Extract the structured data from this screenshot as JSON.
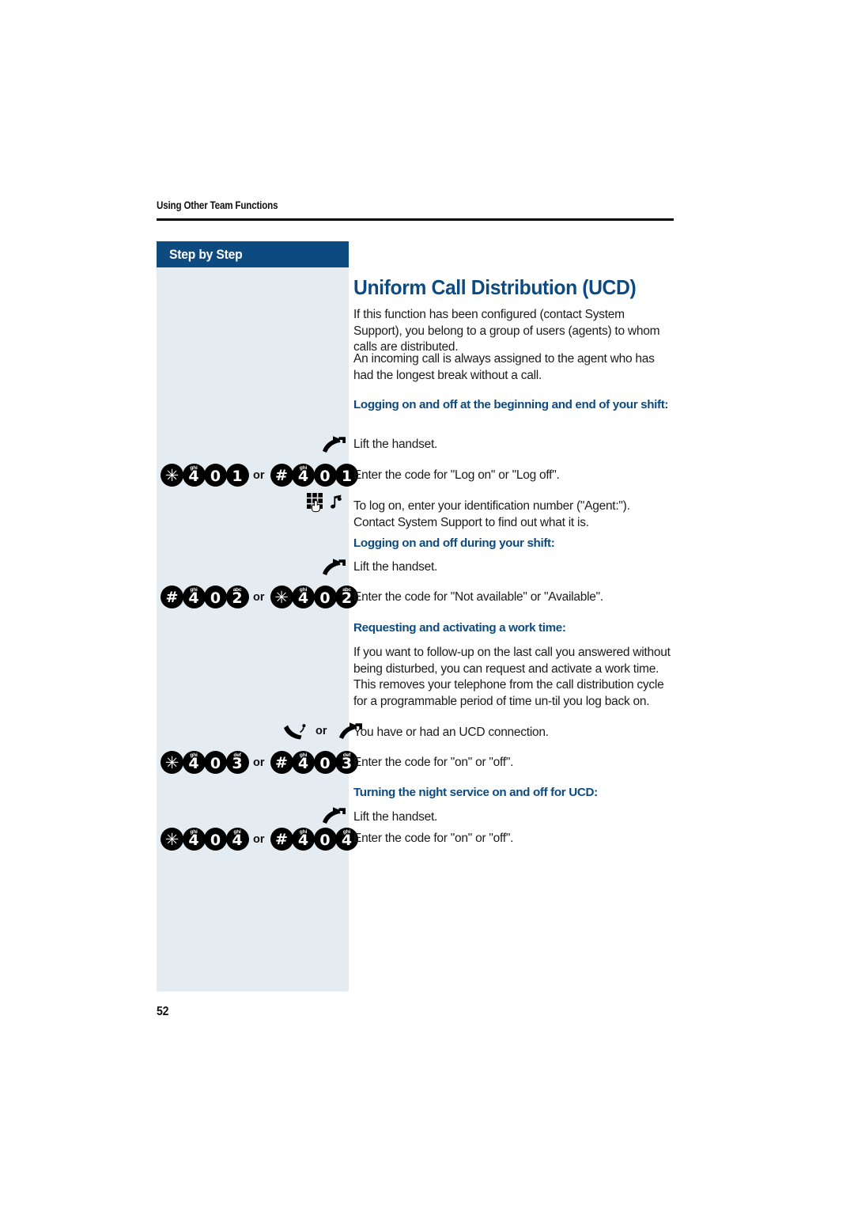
{
  "page": {
    "running_head": "Using Other Team Functions",
    "page_number": "52",
    "accent_color": "#0d4a80",
    "sidebar_color": "#e4ebf1"
  },
  "sidebar": {
    "header_label": "Step by Step"
  },
  "content": {
    "title": "Uniform Call Distribution (UCD)",
    "intro_1": "If this function has been configured (contact System Support), you belong to a group of users (agents) to whom calls are distributed.",
    "intro_2": "An incoming call is always assigned to the agent who has had the longest break without a call.",
    "section_1_heading": "Logging on and off at the beginning and end of your shift:",
    "section_1_step_1": "Lift the handset.",
    "section_1_step_2": "Enter the code for \"Log on\" or \"Log off\".",
    "section_1_step_3": "To log on, enter your identification number (\"Agent:\"). Contact System Support to find out what it is.",
    "section_2_heading": "Logging on and off during your shift:",
    "section_2_step_1": "Lift the handset.",
    "section_2_step_2": "Enter the code for \"Not available\" or \"Available\".",
    "section_3_heading": "Requesting and activating a work time:",
    "section_3_para": "If you want to follow-up on the last call you answered without being disturbed, you can request and activate a work time. This removes your telephone from the call distribution cycle for a programmable period of time un-til you log back on.",
    "section_3_step_1": "You have or had an UCD connection.",
    "section_3_step_2": "Enter the code for \"on\" or \"off\".",
    "section_4_heading": "Turning the night service on and off for UCD:",
    "section_4_step_1": "Lift the handset.",
    "section_4_step_2": "Enter the code for \"on\" or \"off\"."
  },
  "key_sequences": {
    "or_label": "or",
    "row_1": {
      "left": [
        {
          "glyph": "✳",
          "letters": "",
          "type": "star"
        },
        {
          "glyph": "4",
          "letters": "ghi",
          "type": "digit"
        },
        {
          "glyph": "0",
          "letters": "",
          "type": "digit"
        },
        {
          "glyph": "1",
          "letters": "",
          "type": "digit"
        }
      ],
      "right": [
        {
          "glyph": "#",
          "letters": "",
          "type": "hash"
        },
        {
          "glyph": "4",
          "letters": "ghi",
          "type": "digit"
        },
        {
          "glyph": "0",
          "letters": "",
          "type": "digit"
        },
        {
          "glyph": "1",
          "letters": "",
          "type": "digit"
        }
      ]
    },
    "row_2": {
      "left": [
        {
          "glyph": "#",
          "letters": "",
          "type": "hash"
        },
        {
          "glyph": "4",
          "letters": "ghi",
          "type": "digit"
        },
        {
          "glyph": "0",
          "letters": "",
          "type": "digit"
        },
        {
          "glyph": "2",
          "letters": "abc",
          "type": "digit"
        }
      ],
      "right": [
        {
          "glyph": "✳",
          "letters": "",
          "type": "star"
        },
        {
          "glyph": "4",
          "letters": "ghi",
          "type": "digit"
        },
        {
          "glyph": "0",
          "letters": "",
          "type": "digit"
        },
        {
          "glyph": "2",
          "letters": "abc",
          "type": "digit"
        }
      ]
    },
    "row_3": {
      "left": [
        {
          "glyph": "✳",
          "letters": "",
          "type": "star"
        },
        {
          "glyph": "4",
          "letters": "ghi",
          "type": "digit"
        },
        {
          "glyph": "0",
          "letters": "",
          "type": "digit"
        },
        {
          "glyph": "3",
          "letters": "def",
          "type": "digit"
        }
      ],
      "right": [
        {
          "glyph": "#",
          "letters": "",
          "type": "hash"
        },
        {
          "glyph": "4",
          "letters": "ghi",
          "type": "digit"
        },
        {
          "glyph": "0",
          "letters": "",
          "type": "digit"
        },
        {
          "glyph": "3",
          "letters": "def",
          "type": "digit"
        }
      ]
    },
    "row_4": {
      "left": [
        {
          "glyph": "✳",
          "letters": "",
          "type": "star"
        },
        {
          "glyph": "4",
          "letters": "ghi",
          "type": "digit"
        },
        {
          "glyph": "0",
          "letters": "",
          "type": "digit"
        },
        {
          "glyph": "4",
          "letters": "ghi",
          "type": "digit"
        }
      ],
      "right": [
        {
          "glyph": "#",
          "letters": "",
          "type": "hash"
        },
        {
          "glyph": "4",
          "letters": "ghi",
          "type": "digit"
        },
        {
          "glyph": "0",
          "letters": "",
          "type": "digit"
        },
        {
          "glyph": "4",
          "letters": "ghi",
          "type": "digit"
        }
      ]
    }
  },
  "icons": {
    "lift_handset": "lift-handset-icon",
    "handset_ringing": "handset-connected-icon",
    "keypad_hand": "keypad-entry-icon",
    "music_note": "music-note-icon"
  }
}
